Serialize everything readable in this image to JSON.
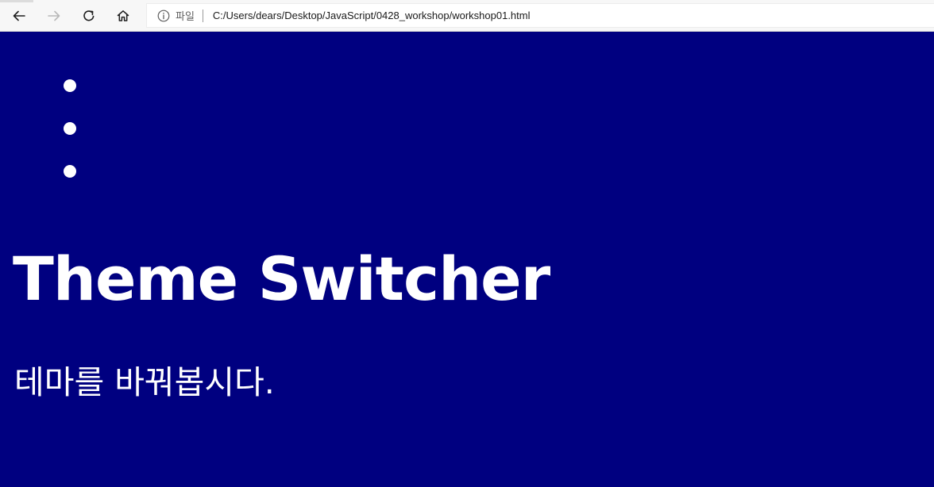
{
  "browser": {
    "address_scheme_label": "파일",
    "url": "C:/Users/dears/Desktop/JavaScript/0428_workshop/workshop01.html",
    "icons": {
      "back": "back-arrow-icon",
      "forward": "forward-arrow-icon",
      "reload": "reload-icon",
      "home": "home-icon",
      "info": "info-icon"
    }
  },
  "page": {
    "background_color": "#000080",
    "text_color": "#ffffff",
    "list_items": [
      "",
      "",
      ""
    ],
    "title": "Theme Switcher",
    "subtitle": "테마를 바꿔봅시다."
  }
}
